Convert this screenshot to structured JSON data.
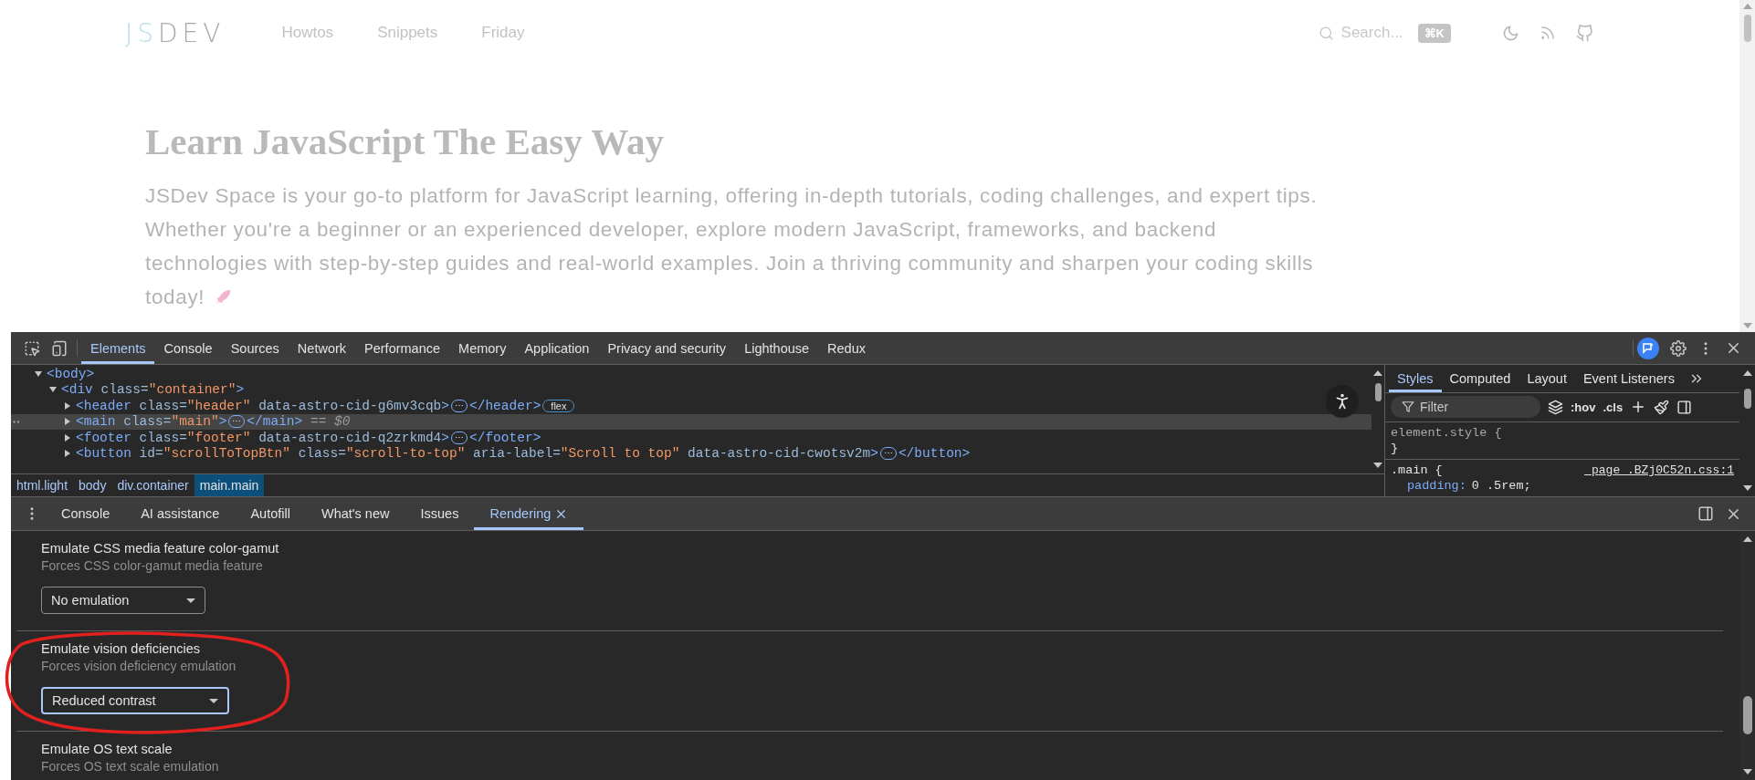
{
  "page": {
    "logo": {
      "accent": "JS",
      "rest": "DEV"
    },
    "nav": [
      "Howtos",
      "Snippets",
      "Friday"
    ],
    "search": {
      "placeholder": "Search...",
      "shortcut": "⌘K"
    },
    "title": "Learn JavaScript The Easy Way",
    "intro": "JSDev Space is your go-to platform for JavaScript learning, offering in-depth tutorials, coding challenges, and expert tips. Whether you're a beginner or an experienced developer, explore modern JavaScript, frameworks, and backend technologies with step-by-step guides and real-world examples. Join a thriving community and sharpen your coding skills today!"
  },
  "devtools": {
    "tabs": [
      {
        "label": "Elements",
        "selected": true
      },
      {
        "label": "Console",
        "selected": false
      },
      {
        "label": "Sources",
        "selected": false
      },
      {
        "label": "Network",
        "selected": false
      },
      {
        "label": "Performance",
        "selected": false
      },
      {
        "label": "Memory",
        "selected": false
      },
      {
        "label": "Application",
        "selected": false
      },
      {
        "label": "Privacy and security",
        "selected": false
      },
      {
        "label": "Lighthouse",
        "selected": false
      },
      {
        "label": "Redux",
        "selected": false
      }
    ],
    "dom_tree": [
      {
        "expanded": true,
        "selected": false,
        "tokens": [
          {
            "kind": "tag",
            "text": "<body>"
          }
        ],
        "children": [
          {
            "expanded": true,
            "selected": false,
            "tokens": [
              {
                "kind": "tag",
                "text": "<div"
              },
              {
                "kind": "attr",
                "text": " class="
              },
              {
                "kind": "value",
                "text": "\"container\""
              },
              {
                "kind": "tag",
                "text": ">"
              }
            ],
            "children": [
              {
                "expanded": false,
                "selected": false,
                "tokens": [
                  {
                    "kind": "tag",
                    "text": "<header"
                  },
                  {
                    "kind": "attr",
                    "text": " class="
                  },
                  {
                    "kind": "value",
                    "text": "\"header\""
                  },
                  {
                    "kind": "attr",
                    "text": " data-astro-cid-g6mv3cqb"
                  },
                  {
                    "kind": "tag",
                    "text": ">"
                  },
                  {
                    "kind": "ellipsis",
                    "text": "⋯"
                  },
                  {
                    "kind": "tag",
                    "text": "</header>"
                  },
                  {
                    "kind": "badge",
                    "text": "flex"
                  }
                ]
              },
              {
                "expanded": false,
                "selected": true,
                "tokens": [
                  {
                    "kind": "tag",
                    "text": "<main"
                  },
                  {
                    "kind": "attr",
                    "text": " class="
                  },
                  {
                    "kind": "value",
                    "text": "\"main\""
                  },
                  {
                    "kind": "tag",
                    "text": ">"
                  },
                  {
                    "kind": "ellipsis",
                    "text": "⋯"
                  },
                  {
                    "kind": "tag",
                    "text": "</main>"
                  },
                  {
                    "kind": "marker",
                    "text": " == $0"
                  }
                ]
              },
              {
                "expanded": false,
                "selected": false,
                "tokens": [
                  {
                    "kind": "tag",
                    "text": "<footer"
                  },
                  {
                    "kind": "attr",
                    "text": " class="
                  },
                  {
                    "kind": "value",
                    "text": "\"footer\""
                  },
                  {
                    "kind": "attr",
                    "text": " data-astro-cid-q2zrkmd4"
                  },
                  {
                    "kind": "tag",
                    "text": ">"
                  },
                  {
                    "kind": "ellipsis",
                    "text": "⋯"
                  },
                  {
                    "kind": "tag",
                    "text": "</footer>"
                  }
                ]
              },
              {
                "expanded": false,
                "selected": false,
                "tokens": [
                  {
                    "kind": "tag",
                    "text": "<button"
                  },
                  {
                    "kind": "attr",
                    "text": " id="
                  },
                  {
                    "kind": "value",
                    "text": "\"scrollToTopBtn\""
                  },
                  {
                    "kind": "attr",
                    "text": " class="
                  },
                  {
                    "kind": "value",
                    "text": "\"scroll-to-top\""
                  },
                  {
                    "kind": "attr",
                    "text": " aria-label="
                  },
                  {
                    "kind": "value",
                    "text": "\"Scroll to top\""
                  },
                  {
                    "kind": "attr",
                    "text": " data-astro-cid-cwotsv2m"
                  },
                  {
                    "kind": "tag",
                    "text": ">"
                  },
                  {
                    "kind": "ellipsis",
                    "text": "⋯"
                  },
                  {
                    "kind": "tag",
                    "text": "</button>"
                  }
                ]
              }
            ]
          }
        ]
      }
    ],
    "breadcrumbs": [
      {
        "label": "html.light",
        "selected": false
      },
      {
        "label": "body",
        "selected": false
      },
      {
        "label": "div.container",
        "selected": false
      },
      {
        "label": "main.main",
        "selected": true
      }
    ],
    "styles": {
      "tabs": [
        {
          "label": "Styles",
          "selected": true
        },
        {
          "label": "Computed",
          "selected": false
        },
        {
          "label": "Layout",
          "selected": false
        },
        {
          "label": "Event Listeners",
          "selected": false
        }
      ],
      "filter": {
        "placeholder": "Filter"
      },
      "toggles": [
        ":hov",
        ".cls"
      ],
      "rules": [
        {
          "selector": "element.style {",
          "close": "}"
        },
        {
          "selector": ".main {",
          "source": "_page_.BZj0C52n.css:1",
          "declarations": [
            {
              "property": "padding:",
              "value": "0 .5rem;"
            }
          ]
        }
      ]
    },
    "drawer": {
      "tabs": [
        {
          "label": "Console",
          "selected": false,
          "closable": false
        },
        {
          "label": "AI assistance",
          "selected": false,
          "closable": false
        },
        {
          "label": "Autofill",
          "selected": false,
          "closable": false
        },
        {
          "label": "What's new",
          "selected": false,
          "closable": false
        },
        {
          "label": "Issues",
          "selected": false,
          "closable": false
        },
        {
          "label": "Rendering",
          "selected": true,
          "closable": true
        }
      ],
      "sections": [
        {
          "title": "Emulate CSS media feature color-gamut",
          "description": "Forces CSS color-gamut media feature",
          "select": {
            "value": "No emulation",
            "focused": false
          }
        },
        {
          "title": "Emulate vision deficiencies",
          "description": "Forces vision deficiency emulation",
          "select": {
            "value": "Reduced contrast",
            "focused": true
          }
        },
        {
          "title": "Emulate OS text scale",
          "description": "Forces OS text scale emulation"
        }
      ]
    }
  }
}
